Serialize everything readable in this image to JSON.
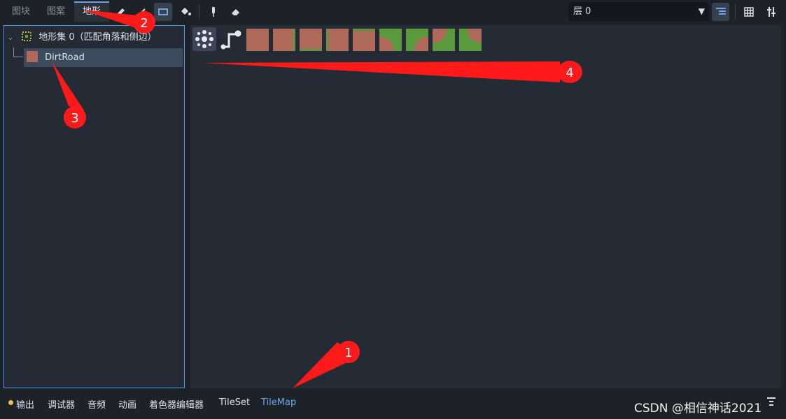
{
  "tabs": [
    {
      "label": "图块",
      "active": false
    },
    {
      "label": "图案",
      "active": false
    },
    {
      "label": "地形",
      "active": true
    }
  ],
  "tools": [
    "pencil-icon",
    "line-icon",
    "rect-icon",
    "bucket-icon",
    "picker-icon",
    "eraser-icon"
  ],
  "layer_select": {
    "value": "层 0"
  },
  "terrain_tree": {
    "terrain_set_label": "地形集 0（匹配角落和侧边）",
    "terrain_label": "DirtRoad"
  },
  "bottom_bar": {
    "items": [
      "输出",
      "调试器",
      "音频",
      "动画",
      "着色器编辑器",
      "TileSet",
      "TileMap"
    ],
    "active": "TileMap"
  },
  "watermark": "CSDN @相信神话2021",
  "callouts": [
    "1",
    "2",
    "3",
    "4"
  ],
  "colors": {
    "accent": "#5d98dd",
    "tile_dirt": "#b06a5c",
    "tile_grass": "#5a9a3c",
    "callout": "#ff0000"
  }
}
